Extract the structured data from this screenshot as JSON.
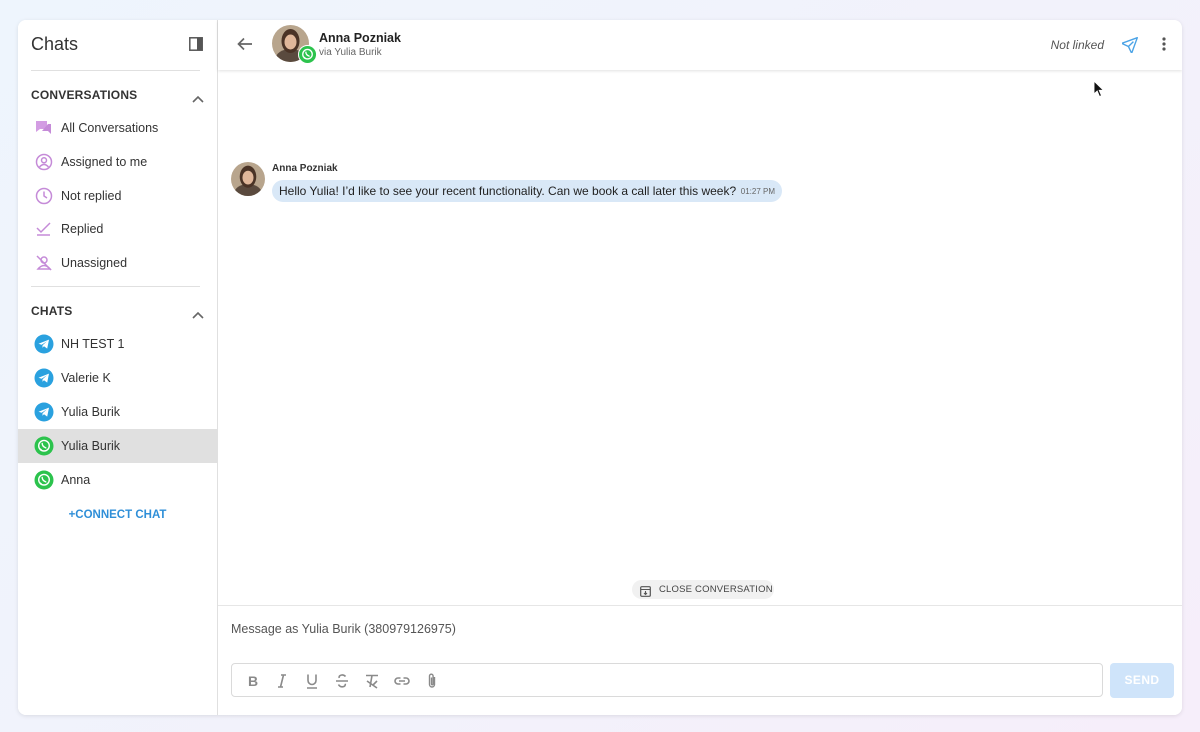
{
  "sidebar": {
    "title": "Chats",
    "conversations_section": {
      "label": "CONVERSATIONS",
      "items": [
        {
          "label": "All Conversations",
          "icon": "chat-bubbles-icon"
        },
        {
          "label": "Assigned to me",
          "icon": "user-circle-icon"
        },
        {
          "label": "Not replied",
          "icon": "clock-icon"
        },
        {
          "label": "Replied",
          "icon": "check-icon"
        },
        {
          "label": "Unassigned",
          "icon": "user-off-icon"
        }
      ]
    },
    "chats_section": {
      "label": "CHATS",
      "items": [
        {
          "label": "NH TEST 1",
          "icon": "telegram-icon"
        },
        {
          "label": "Valerie K",
          "icon": "telegram-icon"
        },
        {
          "label": "Yulia Burik",
          "icon": "telegram-icon"
        },
        {
          "label": "Yulia Burik",
          "icon": "whatsapp-icon",
          "selected": true
        },
        {
          "label": "Anna",
          "icon": "whatsapp-icon"
        }
      ]
    },
    "connect_label": "+CONNECT CHAT"
  },
  "header": {
    "contact_name": "Anna Pozniak",
    "via": "via Yulia Burik",
    "link_status": "Not linked"
  },
  "messages": [
    {
      "sender": "Anna Pozniak",
      "text": "Hello Yulia! I’d like to see your recent functionality. Can we book a call later this week?",
      "time": "01:27 PM"
    }
  ],
  "close_conversation_label": "CLOSE CONVERSATION",
  "composer": {
    "placeholder": "Message as Yulia Burik (380979126975)",
    "value": "",
    "send_label": "SEND"
  },
  "colors": {
    "accent": "#2f8fd8",
    "sidebar_icon": "#c58bd8",
    "telegram": "#2aa1df",
    "whatsapp": "#2cc34d",
    "bubble": "#d9e8f7",
    "send_button": "#cfe4fa"
  }
}
